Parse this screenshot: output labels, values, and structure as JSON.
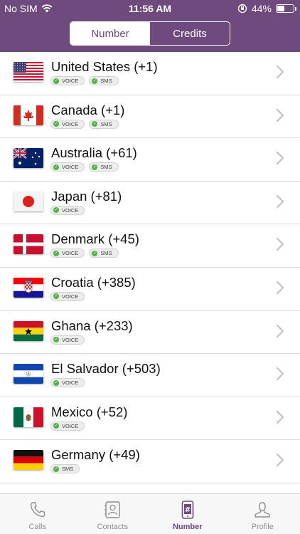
{
  "status_bar": {
    "carrier": "No SIM",
    "time": "11:56 AM",
    "battery": "44%"
  },
  "segment": {
    "left": "Number",
    "right": "Credits",
    "active": "Number"
  },
  "countries": [
    {
      "name": "United States (+1)",
      "flag": "us-flag-icon",
      "badges": [
        "VOICE",
        "SMS"
      ]
    },
    {
      "name": "Canada (+1)",
      "flag": "canada-flag-icon",
      "badges": [
        "VOICE",
        "SMS"
      ]
    },
    {
      "name": "Australia (+61)",
      "flag": "australia-flag-icon",
      "badges": [
        "VOICE",
        "SMS"
      ]
    },
    {
      "name": "Japan (+81)",
      "flag": "japan-flag-icon",
      "badges": [
        "VOICE"
      ]
    },
    {
      "name": "Denmark (+45)",
      "flag": "denmark-flag-icon",
      "badges": [
        "VOICE",
        "SMS"
      ]
    },
    {
      "name": "Croatia (+385)",
      "flag": "croatia-flag-icon",
      "badges": [
        "VOICE"
      ]
    },
    {
      "name": "Ghana (+233)",
      "flag": "ghana-flag-icon",
      "badges": [
        "VOICE"
      ]
    },
    {
      "name": "El Salvador (+503)",
      "flag": "el-salvador-flag-icon",
      "badges": [
        "VOICE"
      ]
    },
    {
      "name": "Mexico (+52)",
      "flag": "mexico-flag-icon",
      "badges": [
        "VOICE"
      ]
    },
    {
      "name": "Germany (+49)",
      "flag": "germany-flag-icon",
      "badges": [
        "SMS"
      ]
    }
  ],
  "tabs": [
    {
      "label": "Calls",
      "icon": "phone-icon"
    },
    {
      "label": "Contacts",
      "icon": "contacts-icon"
    },
    {
      "label": "Number",
      "icon": "number-icon",
      "active": true
    },
    {
      "label": "Profile",
      "icon": "profile-icon"
    }
  ],
  "colors": {
    "brand": "#6e4a7e",
    "check": "#53b245"
  }
}
